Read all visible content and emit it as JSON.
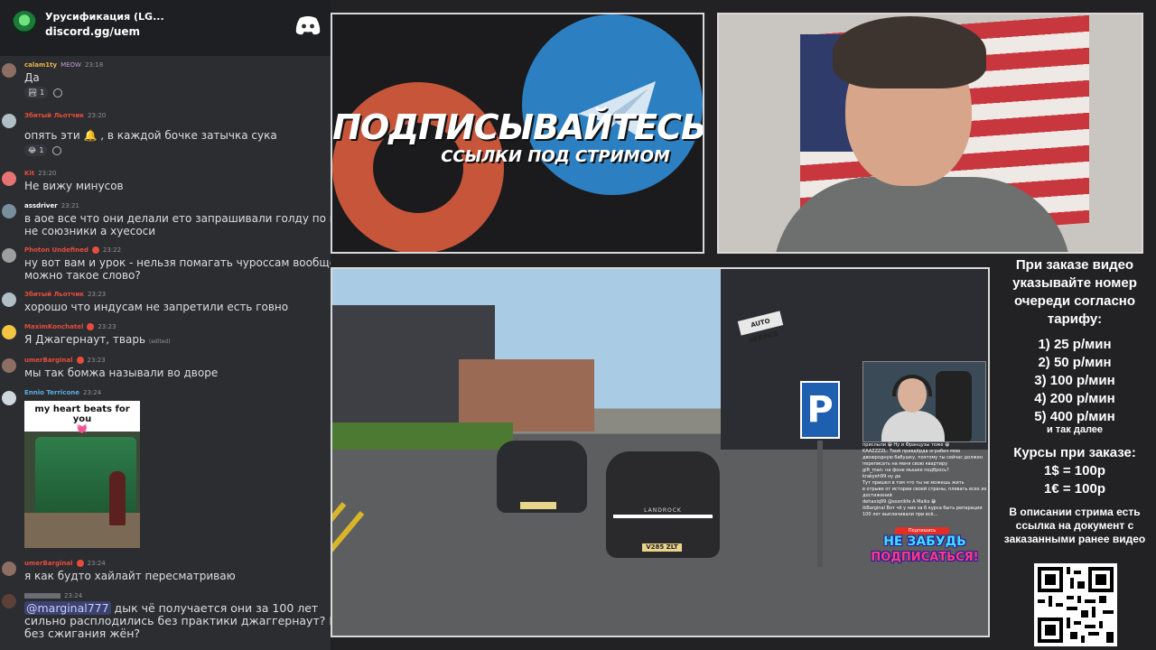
{
  "server": {
    "name": "Урусификация (LG...",
    "invite": "discord.gg/uem"
  },
  "messages": [
    {
      "author": "calam1ty",
      "badge": "MEOW",
      "time": "23:18",
      "text": "Да",
      "reaction_count": "1",
      "author_color": "#e9b44c"
    },
    {
      "author": "Збитый Льотчик",
      "time": "23:20",
      "text": "опять эти 🔔 , в каждой бочке затычка сука",
      "reaction_count": "1",
      "author_color": "#e74c3c"
    },
    {
      "author": "Kit",
      "time": "23:20",
      "text": "Не вижу минусов",
      "author_color": "#e74c3c"
    },
    {
      "author": "assdriver",
      "time": "23:21",
      "text": "в аое все что они делали ето запрашивали голду по кд",
      "text2": "не союзники а хуесоси",
      "author_color": "#ffffff"
    },
    {
      "author": "Photon Undefined",
      "time": "23:22",
      "text": "ну вот вам и урок - нельзя помагать чуроссам вообще",
      "text2": "можно такое слово?",
      "author_color": "#e74c3c"
    },
    {
      "author": "Збитый Льотчик",
      "time": "23:23",
      "text": "хорошо что индусам не запретили есть говно",
      "author_color": "#e74c3c"
    },
    {
      "author": "MaximKonchatel",
      "time": "23:23",
      "text": "Я Джагернаут, тварь",
      "edited": "(edited)",
      "author_color": "#e74c3c"
    },
    {
      "author": "umerBarginal",
      "time": "23:23",
      "text": "мы так бомжа называли во дворе",
      "author_color": "#e74c3c"
    },
    {
      "author": "Ennio Terricone",
      "time": "23:24",
      "author_color": "#5dade2"
    },
    {
      "author": "umerBarginal",
      "time": "23:24",
      "text": "я как будто хайлайт пересматриваю",
      "author_color": "#e74c3c"
    },
    {
      "time": "23:24",
      "mention": "@marginal777",
      "text": " дык чё получается они за 100 лет",
      "text2": "сильно расплодились без практики джаггернаут? И",
      "text3": "без сжигания жён?"
    }
  ],
  "meme": {
    "caption": "my heart beats for you",
    "heart": "💓"
  },
  "promo": {
    "title": "ПОДПИСЫВАЙТЕСЬ",
    "subtitle": "ССЫЛКИ ПОД СТРИМОМ"
  },
  "game": {
    "auto_sign": "AUTO SERVICE",
    "suv_brand": "LANDROCK",
    "suv_plate": "V285 ZLT",
    "parking": "P"
  },
  "mini_chat": [
    "прислыли 😀 Ну и Французы тоже 😀",
    "KAAZZZZL: Твой правдёрда ограбил мою",
    "двоюродную бабушку, поэтому ты сейчас должен",
    "переписать на меня свою квартиру",
    "gift_man: на фоне мышке подбрось?",
    "krakyeh99 ну да",
    "Тут пришел в том что ты не можешь жить",
    "в отрыве от истории своей страны, плевать всех их",
    "достижений",
    "dehaxiq99 @sosnikfe A Maiks 😀",
    "ikBarginal Вот чё у них за 6 курса быть репарации",
    "100 лет выплачивали при всё..."
  ],
  "subscribe": {
    "top": "Подпишись",
    "line1": "НЕ ЗАБУДЬ",
    "line2": "ПОДПИСАТЬСЯ!"
  },
  "info": {
    "intro": "При заказе видео указывайте номер очереди согласно тарифу:",
    "tariffs": [
      "1) 25 р/мин",
      "2) 50 р/мин",
      "3) 100 р/мин",
      "4) 200 р/мин",
      "5) 400 р/мин"
    ],
    "etc": "и так далее",
    "courses_title": "Курсы при заказе:",
    "courses": [
      "1$ = 100р",
      "1€ = 100р"
    ],
    "desc": "В описании стрима есть ссылка на документ с заказанными ранее видео"
  },
  "colors": {
    "chat_bg": "#2b2d31",
    "server_bar": "#1e1f22",
    "page_bg": "#222225",
    "frame": "#d9d9d9"
  }
}
